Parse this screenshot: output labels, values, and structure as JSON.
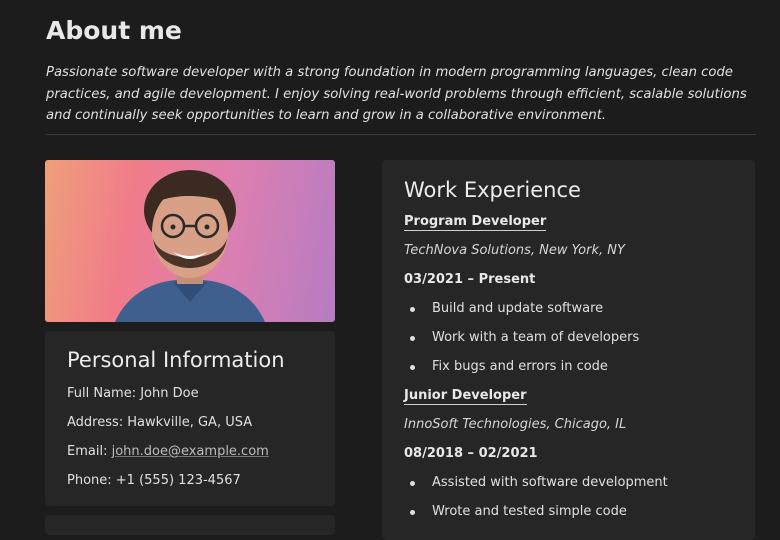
{
  "about": {
    "title": "About me",
    "text": "Passionate software developer with a strong foundation in modern programming languages, clean code practices, and agile development. I enjoy solving real-world problems through efficient, scalable solutions and continually seek opportunities to learn and grow in a collaborative environment."
  },
  "personal": {
    "title": "Personal Information",
    "full_name": "Full Name: John Doe",
    "address": "Address: Hawkville, GA, USA",
    "email_label": "Email: ",
    "email": "john.doe@example.com",
    "phone": "Phone: +1 (555) 123-4567"
  },
  "work": {
    "title": "Work Experience",
    "jobs": [
      {
        "title": "Program Developer",
        "company": "TechNova Solutions, New York, NY",
        "dates": "03/2021 – Present",
        "bullets": [
          "Build and update software",
          "Work with a team of developers",
          "Fix bugs and errors in code"
        ]
      },
      {
        "title": "Junior Developer",
        "company": "InnoSoft Technologies, Chicago, IL",
        "dates": "08/2018 – 02/2021",
        "bullets": [
          "Assisted with software development",
          "Wrote and tested simple code"
        ]
      }
    ]
  }
}
